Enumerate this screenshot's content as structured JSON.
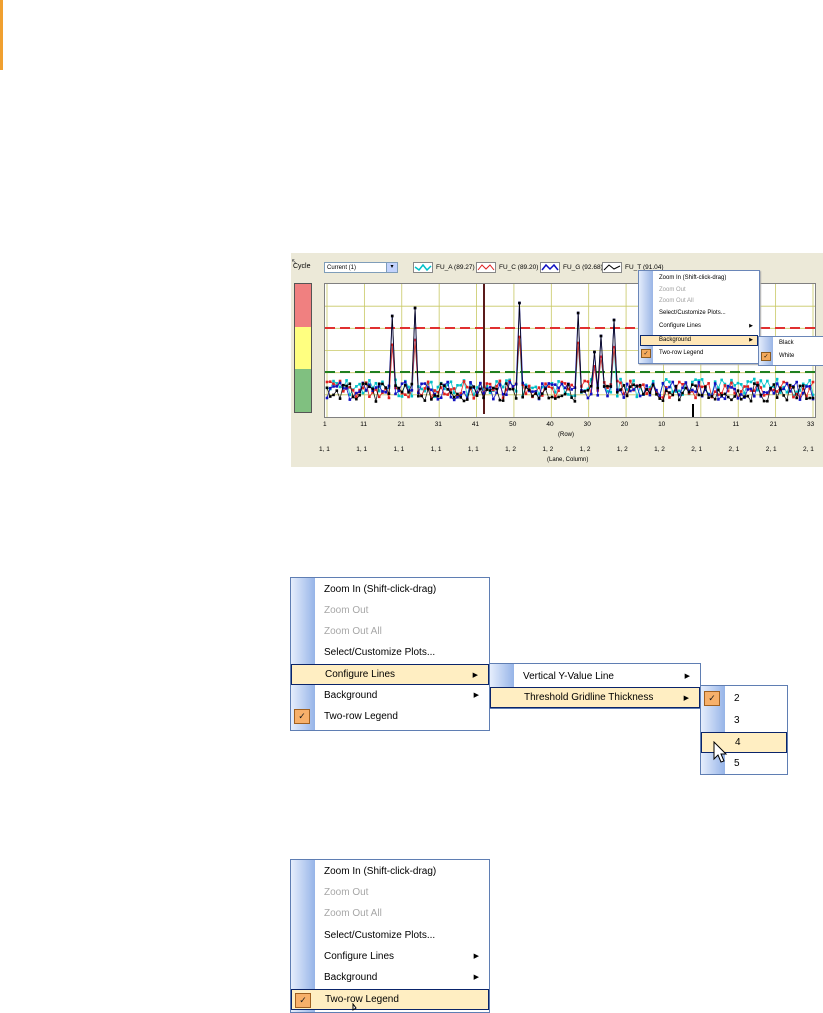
{
  "accent_color": "#f0a030",
  "shot1": {
    "cycle_label": "Cycle",
    "cycle_select_value": "Current (1)",
    "legend": [
      {
        "label": "FU_A (89.27)",
        "color": "#00c0c8"
      },
      {
        "label": "FU_C (89.20)",
        "color": "#e02020"
      },
      {
        "label": "FU_G (92.68)",
        "color": "#1010c0"
      },
      {
        "label": "FU_T (91.04)",
        "color": "#000000"
      }
    ],
    "heat_colors": [
      "#f08080",
      "#ffff80",
      "#80c080"
    ],
    "menu": {
      "items": [
        {
          "label": "Zoom In (Shift-click-drag)"
        },
        {
          "label": "Zoom Out"
        },
        {
          "label": "Zoom Out All"
        },
        {
          "label": "Select/Customize Plots..."
        },
        {
          "label": "Configure Lines"
        },
        {
          "label": "Background"
        },
        {
          "label": "Two-row Legend"
        }
      ],
      "sub_items": [
        {
          "label": "Black"
        },
        {
          "label": "White"
        }
      ]
    }
  },
  "chart_data": {
    "type": "line",
    "title": "",
    "xlabel": "(Row)",
    "xlabel2": "(Lane, Column)",
    "row_ticks": [
      "1",
      "11",
      "21",
      "31",
      "41",
      "50",
      "40",
      "30",
      "20",
      "10",
      "1",
      "11",
      "21",
      "33"
    ],
    "lane_ticks": [
      "1, 1",
      "1, 1",
      "1, 1",
      "1, 1",
      "1, 1",
      "1, 2",
      "1, 2",
      "1, 2",
      "1, 2",
      "1, 2",
      "2, 1",
      "2, 1",
      "2, 1",
      "2, 1"
    ],
    "threshold_lines": [
      {
        "color": "#e03030",
        "level": "upper"
      },
      {
        "color": "#208020",
        "level": "lower"
      }
    ],
    "series": [
      {
        "name": "FU_A",
        "color": "#00c0c8"
      },
      {
        "name": "FU_C",
        "color": "#e02020"
      },
      {
        "name": "FU_G",
        "color": "#1010c0"
      },
      {
        "name": "FU_T",
        "color": "#000000"
      }
    ]
  },
  "shot2": {
    "menu_items": [
      {
        "label": "Zoom In (Shift-click-drag)"
      },
      {
        "label": "Zoom Out"
      },
      {
        "label": "Zoom Out All"
      },
      {
        "label": "Select/Customize Plots..."
      },
      {
        "label": "Configure Lines"
      },
      {
        "label": "Background"
      },
      {
        "label": "Two-row Legend"
      }
    ],
    "configure_sub": [
      {
        "label": "Vertical Y-Value Line"
      },
      {
        "label": "Threshold Gridline Thickness"
      }
    ],
    "thickness_options": [
      "2",
      "3",
      "4",
      "5"
    ]
  },
  "shot3": {
    "menu_items": [
      {
        "label": "Zoom In (Shift-click-drag)"
      },
      {
        "label": "Zoom Out"
      },
      {
        "label": "Zoom Out All"
      },
      {
        "label": "Select/Customize Plots..."
      },
      {
        "label": "Configure Lines"
      },
      {
        "label": "Background"
      },
      {
        "label": "Two-row Legend"
      }
    ]
  }
}
